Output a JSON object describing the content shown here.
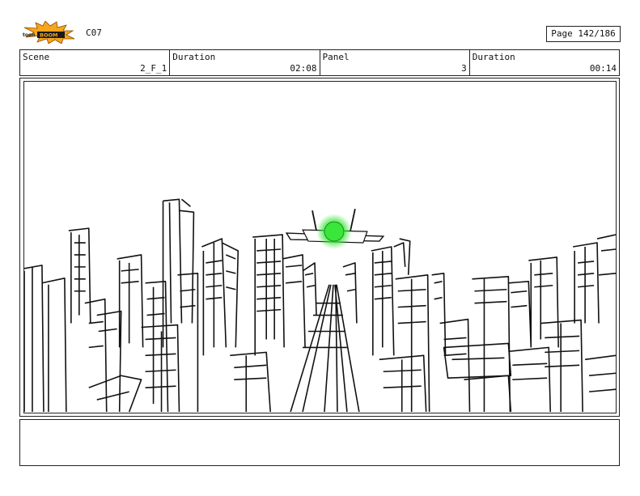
{
  "header": {
    "logo_text": "toonBOOM",
    "episode": "C07",
    "page_label": "Page 142/186"
  },
  "info": {
    "scene_label": "Scene",
    "scene_value": "2_F_1",
    "scene_duration_label": "Duration",
    "scene_duration_value": "02:08",
    "panel_label": "Panel",
    "panel_value": "3",
    "panel_duration_label": "Duration",
    "panel_duration_value": "00:14"
  },
  "colors": {
    "logo_orange": "#f5a51e",
    "ship_glow": "#39e639"
  },
  "notes": ""
}
